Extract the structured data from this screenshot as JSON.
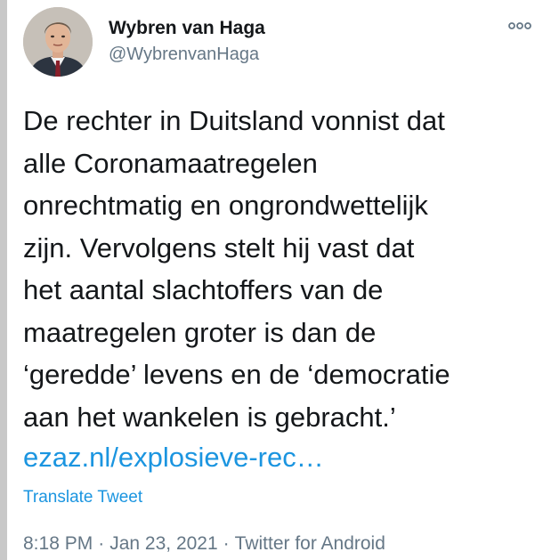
{
  "author": {
    "name": "Wybren van Haga",
    "handle": "@WybrenvanHaga"
  },
  "tweet": {
    "lines": [
      "De rechter in Duitsland vonnist dat",
      "alle Coronamaatregelen",
      "onrechtmatig en ongrondwettelijk",
      "zijn. Vervolgens stelt hij vast dat",
      "het aantal slachtoffers van de",
      "maatregelen groter is dan de",
      "‘geredde’ levens en de ‘democratie",
      "aan het wankelen is gebracht.’"
    ],
    "link": "ezaz.nl/explosieve-rec…",
    "translate_label": "Translate Tweet"
  },
  "meta": {
    "time": "8:18 PM",
    "separator": "·",
    "date": "Jan 23, 2021",
    "source": "Twitter for Android"
  },
  "icons": {
    "more": "more-options-icon"
  },
  "colors": {
    "link": "#1b95e0",
    "secondary_text": "#657786",
    "primary_text": "#14171a"
  }
}
